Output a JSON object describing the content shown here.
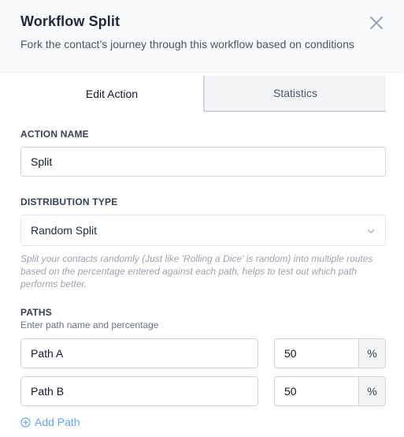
{
  "header": {
    "title": "Workflow Split",
    "subtitle": "Fork the contact’s journey through this workflow based on conditions"
  },
  "tabs": [
    {
      "label": "Edit Action",
      "active": true
    },
    {
      "label": "Statistics",
      "active": false
    }
  ],
  "action_name": {
    "label": "ACTION NAME",
    "value": "Split"
  },
  "distribution": {
    "label": "DISTRIBUTION TYPE",
    "selected": "Random Split",
    "description": "Split your contacts randomly (Just like 'Rolling a Dice' is random) into multiple routes based on the percentage entered against each path, helps to test out which path performs better."
  },
  "paths": {
    "label": "PATHS",
    "hint": "Enter path name and percentage",
    "items": [
      {
        "name": "Path A",
        "percent": "50",
        "suffix": "%"
      },
      {
        "name": "Path B",
        "percent": "50",
        "suffix": "%"
      }
    ],
    "add_label": "Add Path"
  },
  "colors": {
    "accent": "#60a5fa",
    "border": "#d1d5db",
    "header_bg": "#f9fafb"
  },
  "icons": [
    "close-icon",
    "chevron-down-icon",
    "plus-circle-icon"
  ]
}
